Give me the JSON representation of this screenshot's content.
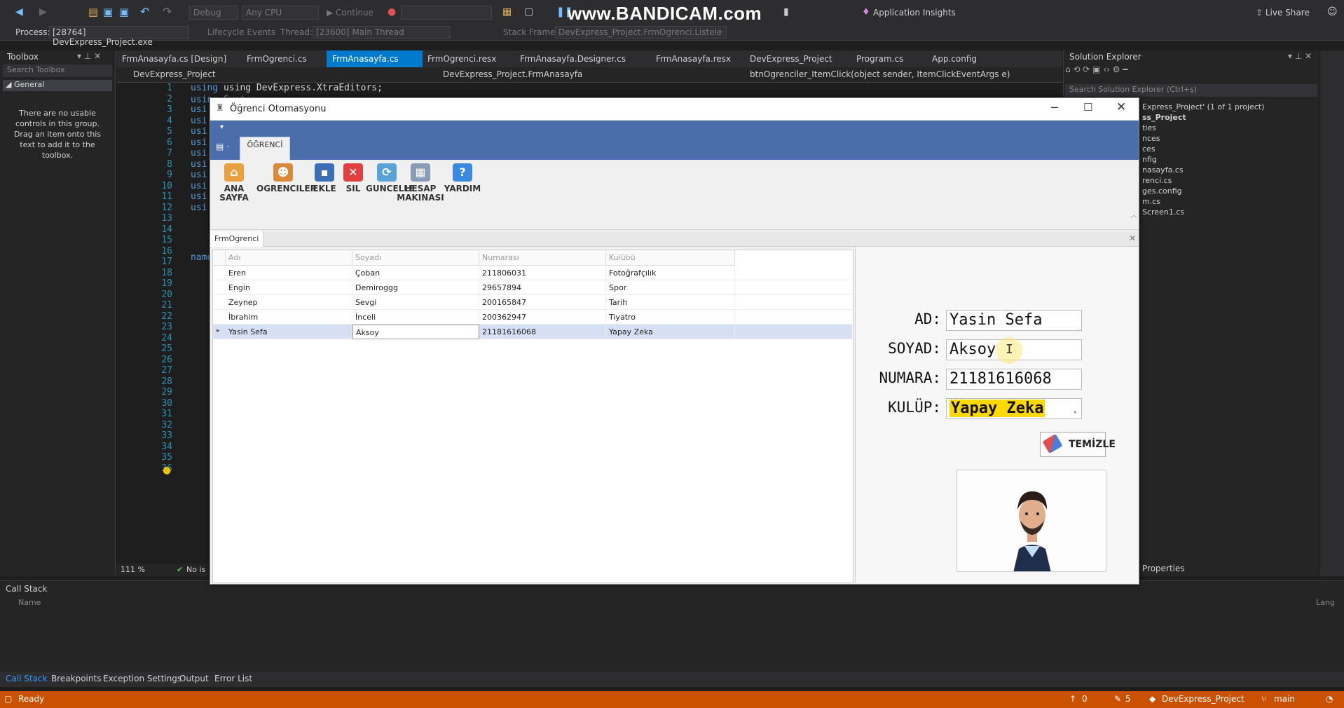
{
  "vs": {
    "config": "Debug",
    "platform": "Any CPU",
    "continue_label": "Continue",
    "watermark": "www.BANDICAM.com",
    "app_insights": "Application Insights",
    "live_share": "Live Share",
    "process_label": "Process:",
    "process_value": "[28764] DevExpress_Project.exe",
    "lifecycle": "Lifecycle Events",
    "thread_label": "Thread:",
    "thread_value": "[23600] Main Thread",
    "stack_frame_label": "Stack Frame:",
    "stack_frame_value": "DevExpress_Project.FrmOgrenci.Listele",
    "toolbox_title": "Toolbox",
    "toolbox_search": "Search Toolbox",
    "toolbox_group": "General",
    "toolbox_empty": "There are no usable controls in this group. Drag an item onto this text to add it to the toolbox.",
    "tabs": [
      "FrmAnasayfa.cs [Design]",
      "FrmOgrenci.cs",
      "FrmAnasayfa.cs",
      "FrmOgrenci.resx",
      "FrmAnasayfa.Designer.cs",
      "FrmAnasayfa.resx",
      "DevExpress_Project",
      "Program.cs",
      "App.config"
    ],
    "nav_project": "DevExpress_Project",
    "nav_class": "DevExpress_Project.FrmAnasayfa",
    "nav_member": "btnOgrenciler_ItemClick(object sender, ItemClickEventArgs e)",
    "code_line1": "using DevExpress.XtraEditors;",
    "code_line2": "using System;",
    "code_using": "usi",
    "code_name": "name",
    "line_numbers": [
      "1",
      "2",
      "3",
      "4",
      "5",
      "6",
      "7",
      "8",
      "9",
      "10",
      "11",
      "12",
      "13",
      "14",
      "15",
      "16",
      "17",
      "18",
      "19",
      "20",
      "21",
      "22",
      "23",
      "24",
      "25",
      "26",
      "27",
      "28",
      "29",
      "30",
      "31",
      "32",
      "33",
      "34",
      "35",
      "36"
    ],
    "zoom": "111 %",
    "no_issues": "No is",
    "solution_title": "Solution Explorer",
    "solution_search": "Search Solution Explorer (Ctrl+ş)",
    "solution_items": [
      "Express_Project' (1 of 1 project)",
      "ss_Project",
      "ties",
      "nces",
      "ces",
      "nfig",
      "nasayfa.cs",
      "renci.cs",
      "ges.config",
      "m.cs",
      "Screen1.cs"
    ],
    "properties": "Properties",
    "callstack_title": "Call Stack",
    "callstack_col": "Name",
    "callstack_lang": "Lang",
    "bottom_tabs": [
      "Call Stack",
      "Breakpoints",
      "Exception Settings",
      "Output",
      "Error List"
    ],
    "status_ready": "Ready",
    "status_up": "0",
    "status_edit": "5",
    "status_project": "DevExpress_Project",
    "status_branch": "main"
  },
  "app": {
    "title": "Öğrenci Otomasyonu",
    "ribbon_tab": "ÖĞRENCİ",
    "buttons": [
      {
        "label": "ANA SAYFA",
        "color": "#e8a040"
      },
      {
        "label": "OGRENCILER",
        "color": "#d88a3a"
      },
      {
        "label": "EKLE",
        "color": "#3b6fb5"
      },
      {
        "label": "SIL",
        "color": "#e04040"
      },
      {
        "label": "GUNCELLE",
        "color": "#5aa3d8"
      },
      {
        "label": "HESAP\nMAKINASI",
        "color": "#8a9bb8"
      },
      {
        "label": "YARDIM",
        "color": "#3a8be0"
      }
    ],
    "doc_tab": "FrmOgrenci",
    "grid": {
      "columns": [
        "Adı",
        "Soyadı",
        "Numarası",
        "Kulübü"
      ],
      "rows": [
        [
          "Eren",
          "Çoban",
          "211806031",
          "Fotoğrafçılık"
        ],
        [
          "Engin",
          "Demiroggg",
          "29657894",
          "Spor"
        ],
        [
          "Zeynep",
          "Sevgi",
          "200165847",
          "Tarih"
        ],
        [
          "İbrahim",
          "İnceli",
          "200362947",
          "Tiyatro"
        ],
        [
          "Yasin Sefa",
          "Aksoy",
          "21181616068",
          "Yapay Zeka"
        ]
      ],
      "selected_row": 4
    },
    "form": {
      "ad_label": "AD:",
      "ad_value": "Yasin Sefa",
      "soyad_label": "SOYAD:",
      "soyad_value": "Aksoy",
      "numara_label": "NUMARA:",
      "numara_value": "21181616068",
      "kulup_label": "KULÜP:",
      "kulup_value": "Yapay Zeka",
      "temizle_label": "TEMİZLE"
    }
  },
  "colors": {
    "vs_accent": "#007acc",
    "status_bar": "#ca5100",
    "ribbon_blue": "#4a6ea9",
    "grid_selected": "#d6dff3",
    "highlight_yellow": "#ffd800"
  }
}
